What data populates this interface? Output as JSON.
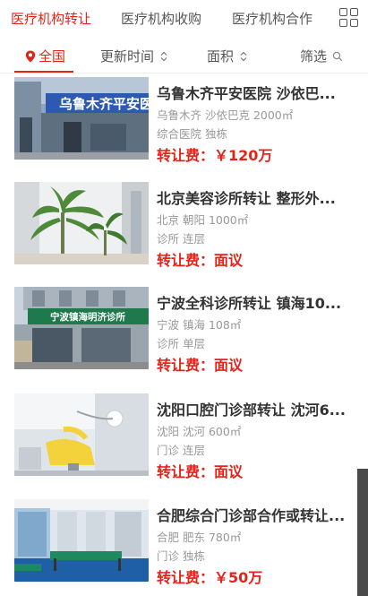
{
  "top_tabs": [
    {
      "label": "医疗机构转让",
      "active": true
    },
    {
      "label": "医疗机构收购",
      "active": false
    },
    {
      "label": "医疗机构合作",
      "active": false
    }
  ],
  "top_icons": {
    "grid": "grid-icon"
  },
  "filters": [
    {
      "label": "全国",
      "icon": "location-pin-icon",
      "active": true
    },
    {
      "label": "更新时间",
      "icon": "chevron-updown-icon"
    },
    {
      "label": "面积",
      "icon": "chevron-updown-icon"
    },
    {
      "label": "筛选",
      "icon": "search-icon"
    }
  ],
  "listings": [
    {
      "title": "乌鲁木齐平安医院 沙依巴...",
      "location": "乌鲁木齐 沙依巴克 2000㎡",
      "type": "综合医院 独栋",
      "price_label": "转让费：",
      "price_value": "￥120万",
      "image_sign": "乌鲁木齐平安医院"
    },
    {
      "title": "北京美容诊所转让 整形外...",
      "location": "北京 朝阳 1000㎡",
      "type": "诊所 连层",
      "price_label": "转让费：",
      "price_value": "面议",
      "image_sign": ""
    },
    {
      "title": "宁波全科诊所转让 镇海10...",
      "location": "宁波 镇海 108㎡",
      "type": "诊所 单层",
      "price_label": "转让费：",
      "price_value": "面议",
      "image_sign": "宁波镇海明济诊所"
    },
    {
      "title": "沈阳口腔门诊部转让 沈河6...",
      "location": "沈阳 沈河 600㎡",
      "type": "门诊 连层",
      "price_label": "转让费：",
      "price_value": "面议",
      "image_sign": ""
    },
    {
      "title": "合肥综合门诊部合作或转让...",
      "location": "合肥 肥东 780㎡",
      "type": "门诊 独栋",
      "price_label": "转让费：",
      "price_value": "￥50万",
      "image_sign": ""
    }
  ],
  "colors": {
    "accent": "#e2231a",
    "muted": "#999999"
  }
}
